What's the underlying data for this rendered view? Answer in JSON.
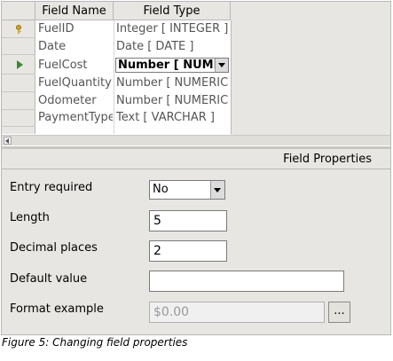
{
  "table": {
    "headers": {
      "field_name": "Field Name",
      "field_type": "Field Type"
    },
    "rows": [
      {
        "name": "FuelID",
        "type": "Integer [ INTEGER ]",
        "marker": "key"
      },
      {
        "name": "Date",
        "type": "Date [ DATE ]",
        "marker": ""
      },
      {
        "name": "FuelCost",
        "type": "Number [ NUMERIC ]",
        "marker": "current"
      },
      {
        "name": "FuelQuantity",
        "type": "Number [ NUMERIC ]",
        "marker": ""
      },
      {
        "name": "Odometer",
        "type": "Number [ NUMERIC ]",
        "marker": ""
      },
      {
        "name": "PaymentType",
        "type": "Text [ VARCHAR ]",
        "marker": ""
      }
    ]
  },
  "properties": {
    "title": "Field Properties",
    "entry_required": {
      "label": "Entry required",
      "value": "No"
    },
    "length": {
      "label": "Length",
      "value": "5"
    },
    "decimal_places": {
      "label": "Decimal places",
      "value": "2"
    },
    "default_value": {
      "label": "Default value",
      "value": ""
    },
    "format_example": {
      "label": "Format example",
      "value": "$0.00",
      "button": "..."
    }
  },
  "caption": "Figure 5: Changing field properties",
  "colors": {
    "panel": "#e8e6e2",
    "current_arrow": "#3c8a2e",
    "key": "#c9a227"
  },
  "icons": {
    "key_row": "key-icon",
    "current_row": "current-row-arrow-icon"
  }
}
